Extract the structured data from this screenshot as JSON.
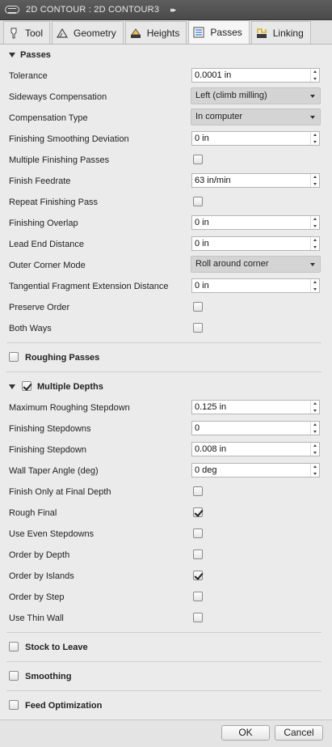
{
  "window": {
    "title": "2D CONTOUR : 2D CONTOUR3",
    "pin": "▸▸"
  },
  "tabs": [
    {
      "label": "Tool",
      "icon": "tool-icon",
      "active": false
    },
    {
      "label": "Geometry",
      "icon": "geometry-icon",
      "active": false
    },
    {
      "label": "Heights",
      "icon": "heights-icon",
      "active": false
    },
    {
      "label": "Passes",
      "icon": "passes-icon",
      "active": true
    },
    {
      "label": "Linking",
      "icon": "linking-icon",
      "active": false
    }
  ],
  "passes": {
    "header": "Passes",
    "tolerance": {
      "label": "Tolerance",
      "value": "0.0001 in"
    },
    "sideways_compensation": {
      "label": "Sideways Compensation",
      "value": "Left (climb milling)"
    },
    "compensation_type": {
      "label": "Compensation Type",
      "value": "In computer"
    },
    "finishing_smoothing_deviation": {
      "label": "Finishing Smoothing Deviation",
      "value": "0 in"
    },
    "multiple_finishing_passes": {
      "label": "Multiple Finishing Passes",
      "checked": false
    },
    "finish_feedrate": {
      "label": "Finish Feedrate",
      "value": "63 in/min"
    },
    "repeat_finishing_pass": {
      "label": "Repeat Finishing Pass",
      "checked": false
    },
    "finishing_overlap": {
      "label": "Finishing Overlap",
      "value": "0 in"
    },
    "lead_end_distance": {
      "label": "Lead End Distance",
      "value": "0 in"
    },
    "outer_corner_mode": {
      "label": "Outer Corner Mode",
      "value": "Roll around corner"
    },
    "tangential_fragment": {
      "label": "Tangential Fragment Extension Distance",
      "value": "0 in"
    },
    "preserve_order": {
      "label": "Preserve Order",
      "checked": false
    },
    "both_ways": {
      "label": "Both Ways",
      "checked": false
    }
  },
  "roughing_passes": {
    "label": "Roughing Passes",
    "checked": false
  },
  "multiple_depths": {
    "label": "Multiple Depths",
    "checked": true,
    "max_roughing_stepdown": {
      "label": "Maximum Roughing Stepdown",
      "value": "0.125 in"
    },
    "finishing_stepdowns": {
      "label": "Finishing Stepdowns",
      "value": "0"
    },
    "finishing_stepdown": {
      "label": "Finishing Stepdown",
      "value": "0.008 in"
    },
    "wall_taper_angle": {
      "label": "Wall Taper Angle (deg)",
      "value": "0 deg"
    },
    "finish_only_final_depth": {
      "label": "Finish Only at Final Depth",
      "checked": false
    },
    "rough_final": {
      "label": "Rough Final",
      "checked": true
    },
    "use_even_stepdowns": {
      "label": "Use Even Stepdowns",
      "checked": false
    },
    "order_by_depth": {
      "label": "Order by Depth",
      "checked": false
    },
    "order_by_islands": {
      "label": "Order by Islands",
      "checked": true
    },
    "order_by_step": {
      "label": "Order by Step",
      "checked": false
    },
    "use_thin_wall": {
      "label": "Use Thin Wall",
      "checked": false
    }
  },
  "stock_to_leave": {
    "label": "Stock to Leave",
    "checked": false
  },
  "smoothing": {
    "label": "Smoothing",
    "checked": false
  },
  "feed_optimization": {
    "label": "Feed Optimization",
    "checked": false
  },
  "buttons": {
    "ok": "OK",
    "cancel": "Cancel"
  }
}
